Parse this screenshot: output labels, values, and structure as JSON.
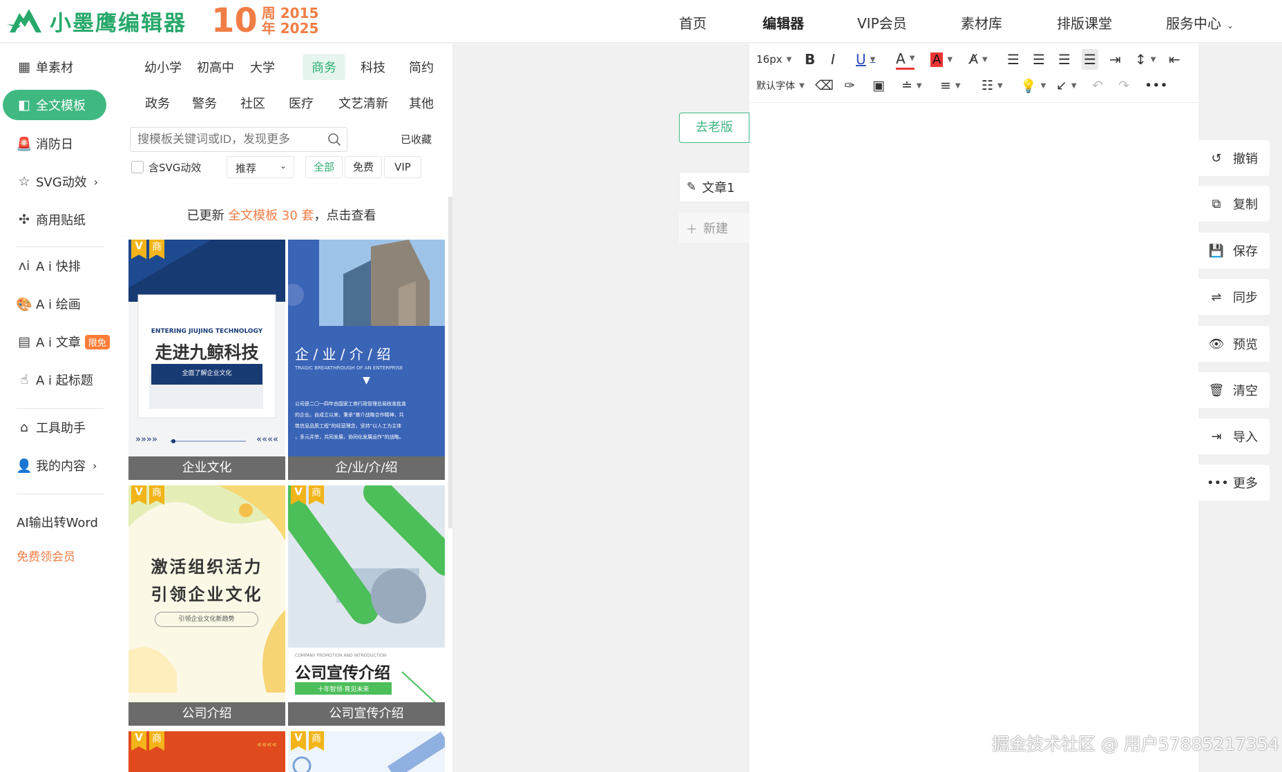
{
  "brand": {
    "name": "小墨鹰编辑器",
    "anniv_num": "10",
    "anniv_line1": "周 2015",
    "anniv_line2": "年 2025"
  },
  "nav": [
    "首页",
    "编辑器",
    "VIP会员",
    "素材库",
    "排版课堂",
    "服务中心"
  ],
  "sidebar": {
    "items": [
      {
        "label": "单素材",
        "icon": "grid-icon"
      },
      {
        "label": "全文模板",
        "icon": "layout-icon"
      },
      {
        "label": "消防日",
        "icon": "siren-icon"
      },
      {
        "label": "SVG动效",
        "icon": "star-icon"
      },
      {
        "label": "商用贴纸",
        "icon": "puzzle-icon"
      },
      {
        "label": "A i 快排",
        "icon": "ai-icon"
      },
      {
        "label": "A i 绘画",
        "icon": "palette-icon"
      },
      {
        "label": "A i 文章",
        "icon": "doc-icon",
        "badge": "限免"
      },
      {
        "label": "A i 起标题",
        "icon": "hand-icon"
      },
      {
        "label": "工具助手",
        "icon": "tool-icon"
      },
      {
        "label": "我的内容",
        "icon": "user-icon"
      }
    ],
    "word": "AI输出转Word",
    "member": "免费领会员"
  },
  "categories_row1": [
    "幼小学",
    "初高中",
    "大学",
    "商务",
    "科技",
    "简约"
  ],
  "categories_row2": [
    "政务",
    "警务",
    "社区",
    "医疗",
    "文艺清新",
    "其他"
  ],
  "search": {
    "placeholder": "搜模板关键词或ID，发现更多"
  },
  "collected": "已收藏",
  "svg_filter": "含SVG动效",
  "sort": "推荐",
  "filters": [
    "全部",
    "免费",
    "VIP"
  ],
  "update": {
    "prefix": "已更新 ",
    "highlight": "全文模板 30 套",
    "suffix": "，点击查看"
  },
  "tag": {
    "v": "V",
    "shang": "商"
  },
  "cards": [
    {
      "caption": "企业文化",
      "en": "ENTERING JIUJING TECHNOLOGY",
      "title": "走进九鲸科技",
      "button": "全面了解企业文化",
      "arrows_left": "»»»»",
      "arrows_right": "««««"
    },
    {
      "caption": "企/业/介/绍",
      "title": "企 / 业 / 介 / 绍",
      "sub": "TRAGIC BREAKTHROUGH OF AN ENTERPRISE",
      "arrow": "▼",
      "body": [
        "公司是二〇一四年由国家工商行政管理总局核准批准",
        "的企业。自成立以来，秉承“推介战略合作精神，共",
        "筑信息品质工程”的经营理念，坚持“以人工为主体",
        "，多元并举，共同发展，协同化发展运作”的战略。"
      ]
    },
    {
      "caption": "公司介绍",
      "line1": "激活组织活力",
      "line2": "引领企业文化",
      "pill": "引领企业文化新趋势"
    },
    {
      "caption": "公司宣传介绍",
      "en": "COMPANY PROMOTION AND INTRODUCTION",
      "title": "公司宣传介绍",
      "band": "十年智领·育见未来"
    },
    {
      "caption": "",
      "arrows": "««««"
    },
    {
      "caption": ""
    }
  ],
  "doc_panel": {
    "old_version": "去老版",
    "doc1": "文章1",
    "new": "新建"
  },
  "toolbar": {
    "font_size": "16px",
    "default_font": "默认字体",
    "bold": "B",
    "italic": "I",
    "underline": "U",
    "font_color": "A",
    "bg_color": "A",
    "clear_format": "A̸"
  },
  "right_actions": [
    "撤销",
    "复制",
    "保存",
    "同步",
    "预览",
    "清空",
    "导入",
    "更多"
  ],
  "watermark": "掘金技术社区 @ 用户57885217354",
  "colors": {
    "brand_green": "#3fb882",
    "accent_orange": "#f07d45",
    "tag_gold": "#f2b418"
  }
}
